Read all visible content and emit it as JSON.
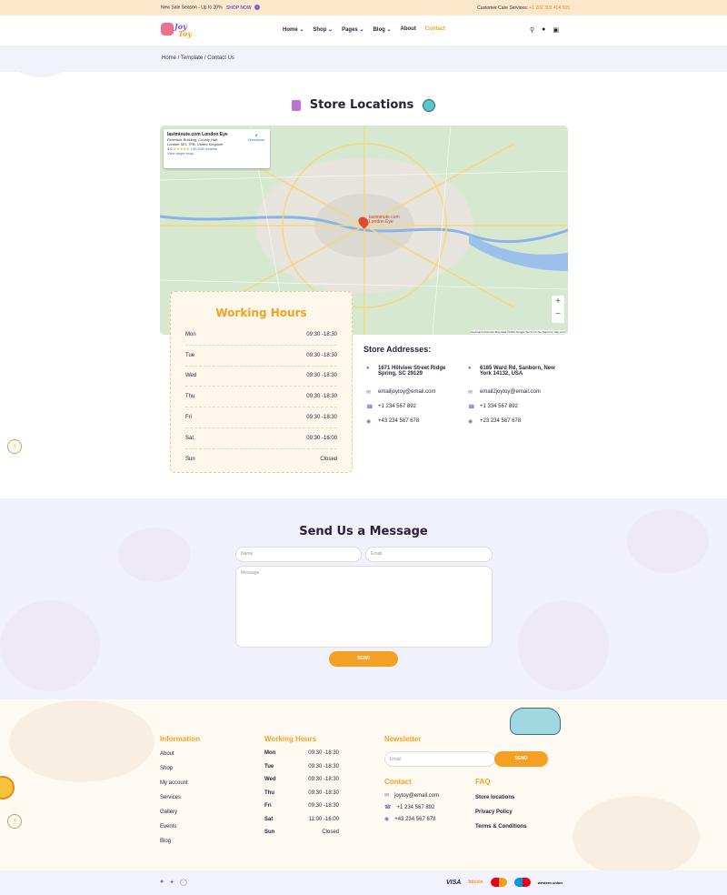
{
  "topbar": {
    "promo": "New Sale Season - Up to 20%",
    "shop_now": "SHOP NOW",
    "care_label": "Customer Care Services:",
    "care_phone": "+1 202 303 404 505"
  },
  "header": {
    "logo_line1": "Joy",
    "logo_line2": "Toy",
    "nav": [
      "Home",
      "Shop",
      "Pages",
      "Blog",
      "About",
      "Contact"
    ],
    "nav_dropdown": [
      true,
      true,
      true,
      true,
      false,
      false
    ],
    "active_nav": "Contact",
    "icons": [
      "search-icon",
      "user-icon",
      "cart-icon"
    ]
  },
  "breadcrumb": "Home / Template / Contact Us",
  "store_locations": {
    "title": "Store Locations",
    "map": {
      "place_name": "lastminute.com London Eye",
      "place_address_1": "Riverside Building, County Hall,",
      "place_address_2": "London SE1 7PB, United Kingdom",
      "rating": "4.5",
      "stars": "★★★★★",
      "reviews": "139,549 reviews",
      "larger_map": "View larger map",
      "directions": "Directions",
      "pin_label_1": "lastminute.com",
      "pin_label_2": "London Eye",
      "zoom_in": "+",
      "zoom_out": "−",
      "footer": "Keyboard shortcuts   Map data ©2022 Google   Terms of Use   Report a map error"
    }
  },
  "working_hours": {
    "title": "Working Hours",
    "rows": [
      {
        "day": "Mon",
        "time": "09:30 -18:30"
      },
      {
        "day": "Tue",
        "time": "09:30 -18:30"
      },
      {
        "day": "Wed",
        "time": "09:30 -18:30"
      },
      {
        "day": "Thu",
        "time": "09:30 -18:30"
      },
      {
        "day": "Fri",
        "time": "09:30 -18:30"
      },
      {
        "day": "Sat",
        "time": "09:30 -16:00"
      },
      {
        "day": "Sun",
        "time": "Closed"
      }
    ]
  },
  "store_addresses": {
    "title": "Store Addresses:",
    "stores": [
      {
        "address": "1671 Hillview Street Ridge Spring, SC 29129",
        "email": "emailjoytoy@email.com",
        "phone": "+1 234 567 892",
        "chat": "+43 234 567 678"
      },
      {
        "address": "6185 Ward Rd, Sanborn, New York 14132, USA",
        "email": "email2joytoy@email.com",
        "phone": "+1 334 567 892",
        "chat": "+23 234 567 678"
      }
    ]
  },
  "message_form": {
    "title": "Send Us a Message",
    "name_placeholder": "Name",
    "email_placeholder": "Email",
    "message_placeholder": "Message",
    "send_label": "SEND"
  },
  "footer": {
    "information_title": "Information",
    "information_links": [
      "About",
      "Shop",
      "My account",
      "Services",
      "Gallery",
      "Events",
      "Blog"
    ],
    "hours_title": "Working Hours",
    "hours": [
      {
        "day": "Mon",
        "time": "09:30 -18:30"
      },
      {
        "day": "Tue",
        "time": "09:30 -18:30"
      },
      {
        "day": "Wed",
        "time": "09:30 -18:30"
      },
      {
        "day": "Thu",
        "time": "09:30 -18:30"
      },
      {
        "day": "Fri",
        "time": "09:30 -18:30"
      },
      {
        "day": "Sat",
        "time": "11:00 -16:00"
      },
      {
        "day": "Sun",
        "time": "Closed"
      }
    ],
    "newsletter_title": "Newsletter",
    "newsletter_placeholder": "Email",
    "newsletter_send": "SEND",
    "contact_title": "Contact",
    "contact_email": "joytoy@email.com",
    "contact_phone": "+1 234 567 892",
    "contact_chat": "+43 234 567 678",
    "faq_title": "FAQ",
    "faq_links": [
      "Store locations",
      "Privacy Policy",
      "Terms & Conditions"
    ],
    "social": [
      "facebook-icon",
      "twitter-icon",
      "instagram-icon"
    ],
    "payments": [
      "VISA",
      "bitcoin",
      "mastercard",
      "maestro",
      "western union"
    ]
  },
  "colors": {
    "accent": "#f4a024",
    "purple": "#7b6fd6",
    "topbar_bg": "#fde8cc"
  }
}
